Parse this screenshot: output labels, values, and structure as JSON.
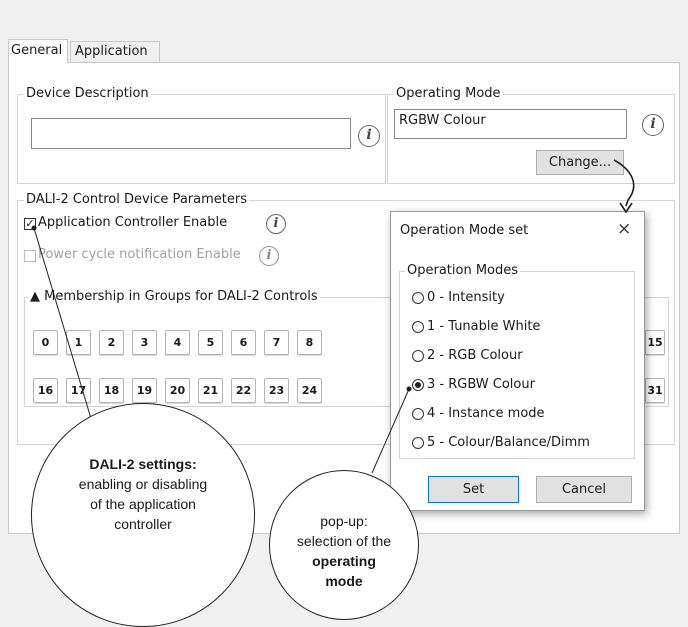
{
  "tabs": [
    {
      "label": "General"
    },
    {
      "label": "Application"
    }
  ],
  "device_description": {
    "legend": "Device Description",
    "value": ""
  },
  "operating_mode": {
    "legend": "Operating Mode",
    "value": "RGBW Colour",
    "change_label": "Change..."
  },
  "dali_params": {
    "legend": "DALI-2 Control Device Parameters",
    "app_controller": {
      "label": "Application Controller Enable",
      "checked": true
    },
    "power_cycle": {
      "label": "Power cycle notification Enable",
      "checked": false,
      "disabled": true
    }
  },
  "membership": {
    "legend": "▲ Membership in Groups for DALI-2 Controls",
    "row1": [
      "0",
      "1",
      "2",
      "3",
      "4",
      "5",
      "6",
      "7",
      "8"
    ],
    "row1_tail": "15",
    "row2": [
      "16",
      "17",
      "18",
      "19",
      "20",
      "21",
      "22",
      "23",
      "24"
    ],
    "row2_tail": "31"
  },
  "dialog": {
    "title": "Operation Mode set",
    "close_glyph": "×",
    "group_legend": "Operation Modes",
    "options": [
      {
        "label": "0 - Intensity",
        "selected": false
      },
      {
        "label": "1 - Tunable White",
        "selected": false
      },
      {
        "label": "2 - RGB Colour",
        "selected": false
      },
      {
        "label": "3 - RGBW Colour",
        "selected": true
      },
      {
        "label": "4 - Instance mode",
        "selected": false
      },
      {
        "label": "5 - Colour/Balance/Dimm",
        "selected": false
      }
    ],
    "set_label": "Set",
    "cancel_label": "Cancel"
  },
  "callouts": {
    "left": {
      "bold": "DALI-2 settings:",
      "text": "enabling or disabling of the application controller"
    },
    "right": {
      "pre": "pop-up: selection of the",
      "bold": "operating mode"
    }
  },
  "info_glyph": "i"
}
